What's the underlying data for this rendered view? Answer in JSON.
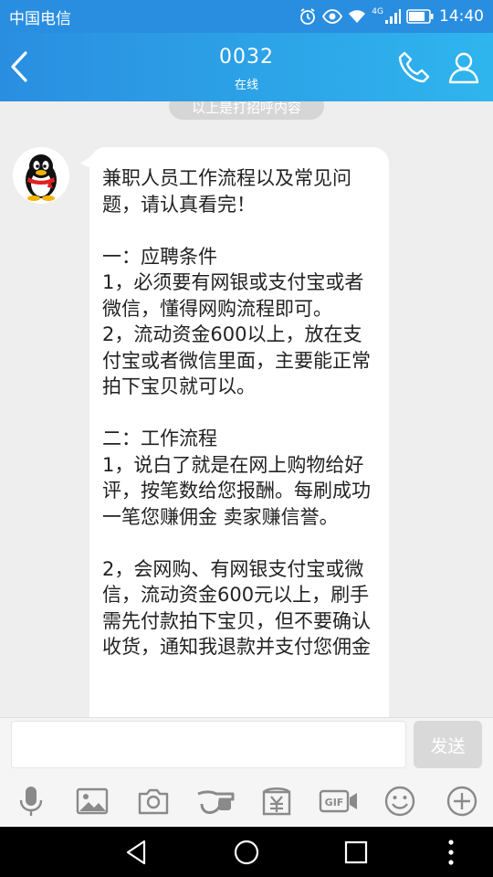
{
  "status_bar": {
    "carrier": "中国电信",
    "network": "4G",
    "time": "14:40"
  },
  "header": {
    "title": "0032",
    "subtitle": "在线"
  },
  "chat": {
    "notice": "以上是打招呼内容",
    "message": "兼职人员工作流程以及常见问题，请认真看完！\n\n一：应聘条件\n1，必须要有网银或支付宝或者微信，懂得网购流程即可。\n2，流动资金600以上，放在支付宝或者微信里面，主要能正常拍下宝贝就可以。\n\n二：工作流程\n1，说白了就是在网上购物给好评，按笔数给您报酬。每刷成功一笔您赚佣金 卖家赚信誉。\n\n2，会网购、有网银支付宝或微信，流动资金600元以上，刷手需先付款拍下宝贝，但不要确认收货，通知我退款并支付您佣金"
  },
  "input": {
    "value": "",
    "placeholder": "",
    "send_label": "发送"
  },
  "toolbar": {
    "gif_label": "GIF"
  },
  "colors": {
    "header_start": "#2a8ee0",
    "header_end": "#2fb5ee",
    "chat_bg": "#eeeeee",
    "icon_gray": "#8a8a8a"
  },
  "icons": [
    "back-arrow-icon",
    "phone-icon",
    "profile-icon",
    "microphone-icon",
    "image-icon",
    "camera-icon",
    "hongbao-icon",
    "gif-icon",
    "emoji-icon",
    "plus-icon"
  ]
}
